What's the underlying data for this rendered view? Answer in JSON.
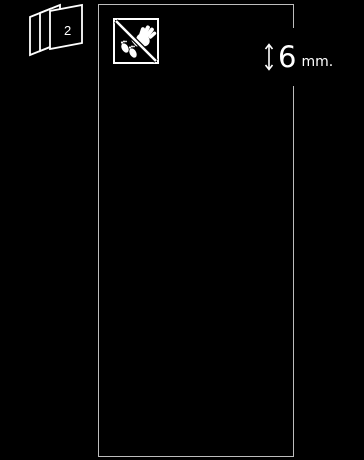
{
  "layers": {
    "count": "2",
    "icon": "stacked-sheets-icon"
  },
  "surface": {
    "icon": "no-walking-hand-only-icon"
  },
  "thickness": {
    "value": "6",
    "unit": "mm.",
    "icon": "vertical-double-arrow-icon"
  },
  "colors": {
    "background": "#000000",
    "foreground": "#ffffff",
    "panel_border": "#bdbdbd"
  }
}
